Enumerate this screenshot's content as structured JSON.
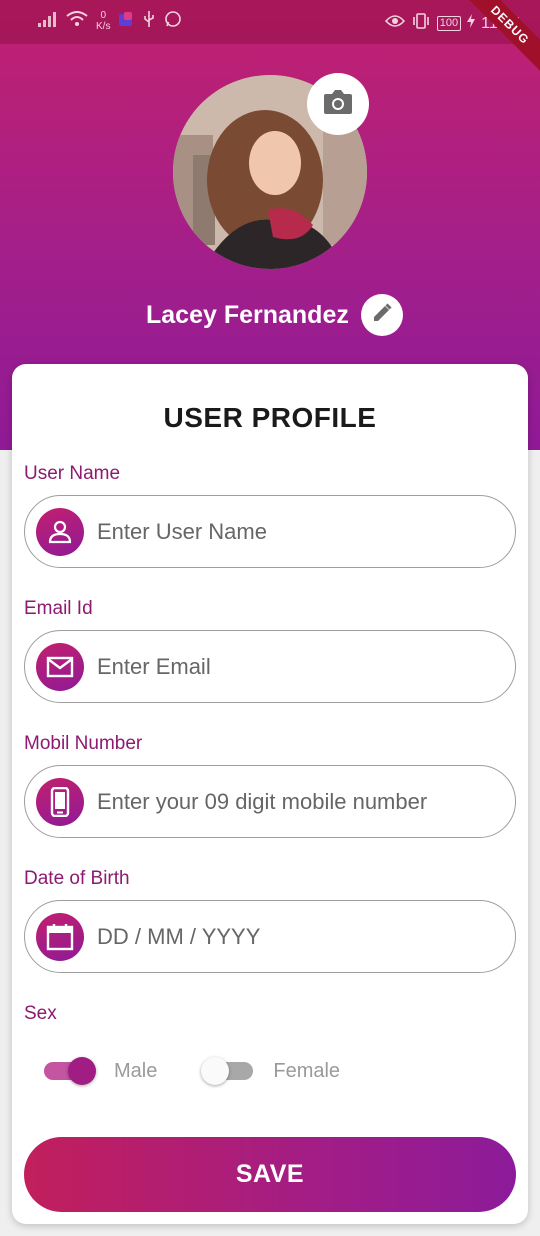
{
  "status_bar": {
    "net_speed_value": "0",
    "net_speed_unit": "K/s",
    "battery": "100",
    "time": "11:55",
    "debug_banner": "DEBUG"
  },
  "profile": {
    "name": "Lacey Fernandez"
  },
  "form": {
    "title": "USER PROFILE",
    "fields": [
      {
        "label": "User Name",
        "placeholder": "Enter User Name",
        "icon": "person-icon"
      },
      {
        "label": "Email Id",
        "placeholder": "Enter Email",
        "icon": "mail-icon"
      },
      {
        "label": "Mobil Number",
        "placeholder": "Enter your 09 digit mobile number",
        "icon": "phone-icon"
      },
      {
        "label": "Date of Birth",
        "placeholder": "DD / MM / YYYY",
        "icon": "calendar-icon"
      }
    ],
    "sex": {
      "label": "Sex",
      "options": [
        {
          "label": "Male",
          "selected": true
        },
        {
          "label": "Female",
          "selected": false
        }
      ]
    },
    "save_label": "SAVE"
  },
  "colors": {
    "accent": "#8d1a70",
    "gradient_start": "#c2206e",
    "gradient_end": "#8f1a96"
  }
}
